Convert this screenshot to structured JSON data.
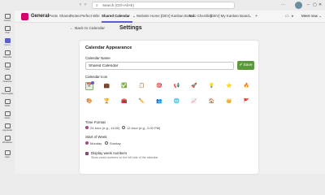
{
  "titlebar": {
    "search_placeholder": "Search (Ctrl+Alt+E)",
    "back_icon": "chevron-left-icon",
    "forward_icon": "chevron-right-icon"
  },
  "rail": {
    "items": [
      {
        "label": "Activity",
        "icon": "bell-icon"
      },
      {
        "label": "Chat",
        "icon": "chat-icon"
      },
      {
        "label": "Teams",
        "icon": "teams-icon",
        "active": true
      },
      {
        "label": "Calendar",
        "icon": "calendar-icon"
      },
      {
        "label": "Calls",
        "icon": "phone-icon"
      },
      {
        "label": "OneDrive",
        "icon": "cloud-icon"
      },
      {
        "label": "Viva Insights",
        "icon": "insights-icon"
      },
      {
        "label": "Shifts",
        "icon": "shifts-icon"
      },
      {
        "label": "Notes",
        "icon": "notes-icon"
      },
      {
        "label": "Approvals",
        "icon": "approvals-icon"
      },
      {
        "label": "Workflows",
        "icon": "workflow-icon"
      },
      {
        "label": "Apps",
        "icon": "apps-icon"
      }
    ]
  },
  "channel": {
    "name": "General",
    "brand_color": "#d6006d",
    "tabs": [
      "Posts",
      "Shared",
      "Notes",
      "Perfect Wiki",
      "Shared Calendar",
      "Website",
      "Home",
      "[DEV] Kanban Board",
      "Todo Checklist",
      "[DEV] My Kanban Board"
    ],
    "active_tab": 4,
    "meet_label": "Meet now"
  },
  "page": {
    "back_label": "Back to Calendar",
    "title": "Settings"
  },
  "appearance": {
    "section_title": "Calendar Appearance",
    "name_label": "Calendar Name",
    "name_value": "Shared Calendar",
    "save_label": "Save",
    "save_color": "#5b9a3c",
    "icon_label": "Calendar Icon",
    "icons": [
      {
        "name": "calendar-icon",
        "glyph": "📅",
        "selected": true
      },
      {
        "name": "briefcase-icon",
        "glyph": "💼"
      },
      {
        "name": "checkbox-icon",
        "glyph": "✅"
      },
      {
        "name": "clipboard-icon",
        "glyph": "📋"
      },
      {
        "name": "target-icon",
        "glyph": "🎯"
      },
      {
        "name": "megaphone-icon",
        "glyph": "📢"
      },
      {
        "name": "rocket-icon",
        "glyph": "🚀"
      },
      {
        "name": "lightbulb-icon",
        "glyph": "💡"
      },
      {
        "name": "star-icon",
        "glyph": "⭐"
      },
      {
        "name": "fire-icon",
        "glyph": "🔥"
      },
      {
        "name": "palette-icon",
        "glyph": "🎨"
      },
      {
        "name": "trophy-icon",
        "glyph": "🏆"
      },
      {
        "name": "toolbox-icon",
        "glyph": "🧰"
      },
      {
        "name": "pencil-icon",
        "glyph": "✏️"
      },
      {
        "name": "people-icon",
        "glyph": "👥"
      },
      {
        "name": "globe-icon",
        "glyph": "🌐"
      },
      {
        "name": "chart-icon",
        "glyph": "📈"
      },
      {
        "name": "house-icon",
        "glyph": "🏠"
      },
      {
        "name": "crown-icon",
        "glyph": "👑"
      },
      {
        "name": "flag-icon",
        "glyph": "🚩"
      }
    ],
    "time_format_label": "Time Format",
    "time_options": [
      "24-hour (e.g., 14:00)",
      "12-hour (e.g., 2:00 PM)"
    ],
    "time_selected": 0,
    "week_label": "Start of Week",
    "week_options": [
      "Monday",
      "Sunday"
    ],
    "week_selected": 0,
    "week_numbers_label": "Display week numbers",
    "week_numbers_help": "Show week numbers on the left side of the calendar",
    "week_numbers_checked": true,
    "accent_color": "#a1437e"
  }
}
